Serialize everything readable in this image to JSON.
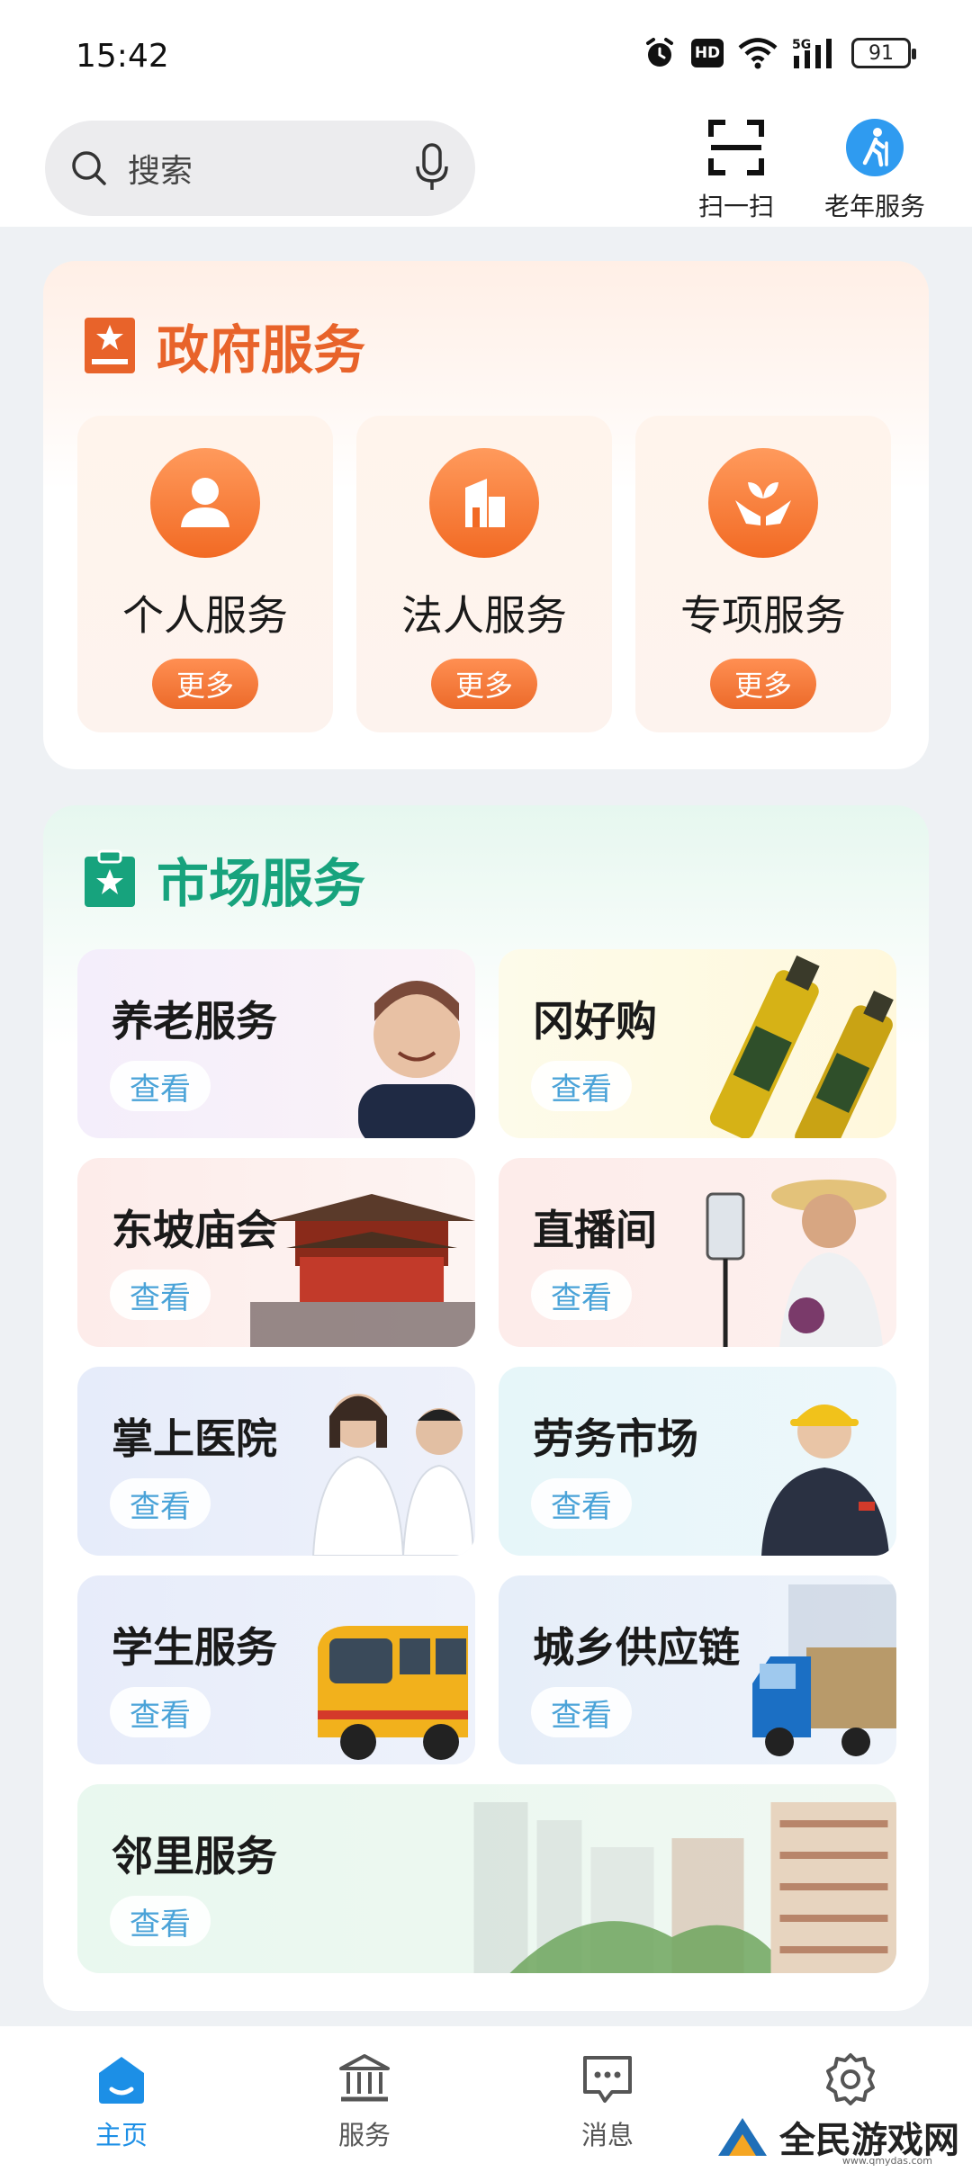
{
  "status_bar": {
    "time": "15:42",
    "hd_label": "HD",
    "network_label": "5G",
    "battery": "91",
    "icons": [
      "alarm-icon",
      "hd-icon",
      "wifi-icon",
      "signal-5g-icon",
      "battery-icon"
    ]
  },
  "header": {
    "search_placeholder": "搜索",
    "scan_label": "扫一扫",
    "elderly_label": "老年服务"
  },
  "gov_services": {
    "title": "政府服务",
    "items": [
      {
        "label": "个人服务",
        "more": "更多",
        "icon": "person-icon"
      },
      {
        "label": "法人服务",
        "more": "更多",
        "icon": "building-icon"
      },
      {
        "label": "专项服务",
        "more": "更多",
        "icon": "hands-leaf-icon"
      }
    ]
  },
  "market_services": {
    "title": "市场服务",
    "items": [
      {
        "label": "养老服务",
        "view": "查看"
      },
      {
        "label": "冈好购",
        "view": "查看"
      },
      {
        "label": "东坡庙会",
        "view": "查看"
      },
      {
        "label": "直播间",
        "view": "查看"
      },
      {
        "label": "掌上医院",
        "view": "查看"
      },
      {
        "label": "劳务市场",
        "view": "查看"
      },
      {
        "label": "学生服务",
        "view": "查看"
      },
      {
        "label": "城乡供应链",
        "view": "查看"
      },
      {
        "label": "邻里服务",
        "view": "查看"
      }
    ]
  },
  "bottom_nav": [
    {
      "label": "主页",
      "icon": "home-icon",
      "active": true
    },
    {
      "label": "服务",
      "icon": "bank-icon",
      "active": false
    },
    {
      "label": "消息",
      "icon": "message-icon",
      "active": false
    },
    {
      "label": "",
      "icon": "settings-icon",
      "active": false
    }
  ],
  "watermark": {
    "text": "全民游戏网",
    "url": "www.qmydas.com"
  },
  "colors": {
    "accent_blue": "#1c8fe6",
    "gov_orange": "#e8632a",
    "market_green": "#17a37d",
    "view_text": "#4aa3d8"
  }
}
